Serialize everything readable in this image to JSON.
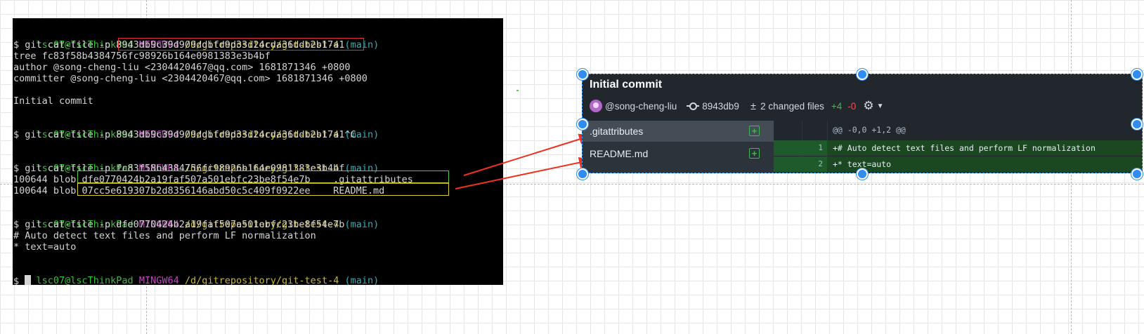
{
  "terminal": {
    "prompt_user": "lsc07@lscThinkPad",
    "prompt_env": "MINGW64",
    "prompt_path": "/d/gitrepository/git-test-4",
    "prompt_branch": "(main)",
    "cmd1": "$ git cat-file -p 8943db9c39d909ddbfd9d33d24cda36ddb2b17a1",
    "out1_tree": "tree fc83f58b4384756fc98926b164e0981383e3b4bf",
    "out1_author": "author @song-cheng-liu <2304420467@qq.com> 1681871346 +0800",
    "out1_committer": "committer @song-cheng-liu <2304420467@qq.com> 1681871346 +0800",
    "out1_message": "Initial commit",
    "cmd2": "$ git cat-file -p 8943db9c39d909ddbfd9d33d24cda36ddb2b17a1^C",
    "cmd3": "$ git cat-file -p fc83f58b4384756fc98926b164e0981383e3b4bf",
    "out3_blob1": "100644 blob dfe0770424b2a19faf507a501ebfc23be8f54e7b    .gitattributes",
    "out3_blob2": "100644 blob 07cc5e619307b2d8356146abd50c5c409f0922ee    README.md",
    "cmd4": "$ git cat-file -p dfe0770424b2a19faf507a501ebfc23be8f54e7b",
    "out4_line1": "# Auto detect text files and perform LF normalization",
    "out4_line2": "* text=auto",
    "last_prompt": "$ "
  },
  "commit_card": {
    "title": "Initial commit",
    "author": "@song-cheng-liu",
    "sha": "8943db9",
    "changed_files": "2 changed files",
    "additions": "+4",
    "deletions": "-0",
    "files": [
      {
        "name": ".gitattributes"
      },
      {
        "name": "README.md"
      }
    ],
    "diff": {
      "hunk_header": "@@ -0,0 +1,2 @@",
      "lines": [
        {
          "num": "1",
          "text": "+# Auto detect text files and perform LF normalization"
        },
        {
          "num": "2",
          "text": "+* text=auto"
        }
      ]
    }
  },
  "colors": {
    "highlight_red": "#e03030",
    "highlight_green": "#4cc94c",
    "highlight_yellow": "#d9d02a",
    "arrow_red": "#f03020",
    "selection_blue": "#2f8cf0"
  },
  "icons": [
    "avatar-icon",
    "commit-icon",
    "plus-minus-icon",
    "gear-icon",
    "chevron-down-icon",
    "file-added-icon",
    "cursor-icon"
  ]
}
